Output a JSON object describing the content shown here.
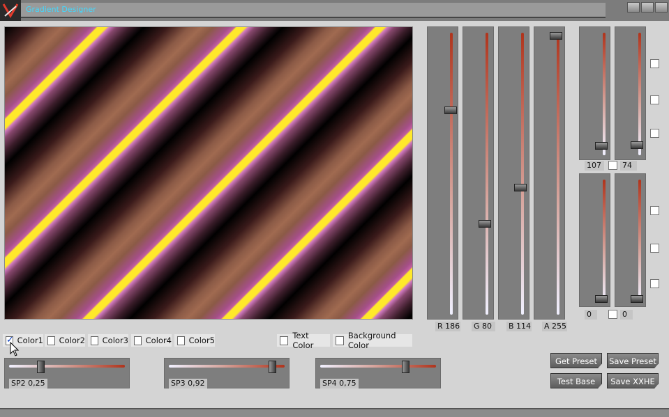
{
  "window": {
    "title": "Gradient Designer"
  },
  "sliders": [
    {
      "label": "R 186",
      "value": 186,
      "max": 255
    },
    {
      "label": "G 80",
      "value": 80,
      "max": 255
    },
    {
      "label": "B 114",
      "value": 114,
      "max": 255
    },
    {
      "label": "A 255",
      "value": 255,
      "max": 255
    }
  ],
  "small_sliders": {
    "top_left": "107",
    "top_right": "74",
    "bottom_left": "0",
    "bottom_right": "0"
  },
  "color_options": [
    {
      "label": "Color1",
      "checked": true
    },
    {
      "label": "Color2",
      "checked": false
    },
    {
      "label": "Color3",
      "checked": false
    },
    {
      "label": "Color4",
      "checked": false
    },
    {
      "label": "Color5",
      "checked": false
    }
  ],
  "text_color_label": "Text Color",
  "background_color_label": "Background Color",
  "sp_sliders": [
    {
      "label": "SP2 0,25",
      "value": 0.25
    },
    {
      "label": "SP3 0,92",
      "value": 0.92
    },
    {
      "label": "SP4 0,75",
      "value": 0.75
    }
  ],
  "buttons": {
    "get_preset": "Get Preset",
    "save_preset": "Save Preset",
    "test_base": "Test Base",
    "save_xhe": "Save XXHE"
  },
  "colors": {
    "accent": "#41d9ff",
    "stripe_yellow": "#ffe92a",
    "stripe_brown": "#a06a50",
    "stripe_pink": "#c15fa0"
  }
}
